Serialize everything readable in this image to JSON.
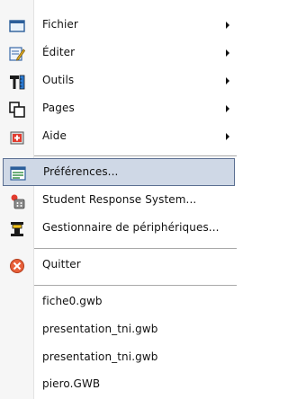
{
  "menu": {
    "items": [
      {
        "label": "Fichier",
        "icon": "folder-icon",
        "has_submenu": true
      },
      {
        "label": "Éditer",
        "icon": "edit-icon",
        "has_submenu": true
      },
      {
        "label": "Outils",
        "icon": "tools-icon",
        "has_submenu": true
      },
      {
        "label": "Pages",
        "icon": "pages-icon",
        "has_submenu": true
      },
      {
        "label": "Aide",
        "icon": "help-icon",
        "has_submenu": true
      }
    ],
    "settings": [
      {
        "label": "Préférences...",
        "icon": "preferences-icon",
        "highlighted": true
      },
      {
        "label": "Student Response System...",
        "icon": "student-response-icon"
      },
      {
        "label": "Gestionnaire de périphériques...",
        "icon": "device-manager-icon"
      }
    ],
    "quit": {
      "label": "Quitter",
      "icon": "quit-icon"
    },
    "recent_files": [
      {
        "label": "fiche0.gwb"
      },
      {
        "label": "presentation_tni.gwb"
      },
      {
        "label": "presentation_tni.gwb"
      },
      {
        "label": "piero.GWB"
      }
    ]
  },
  "colors": {
    "highlight_bg": "#cfd8e6",
    "highlight_border": "#5b6f92",
    "separator": "#a9a9a9"
  }
}
